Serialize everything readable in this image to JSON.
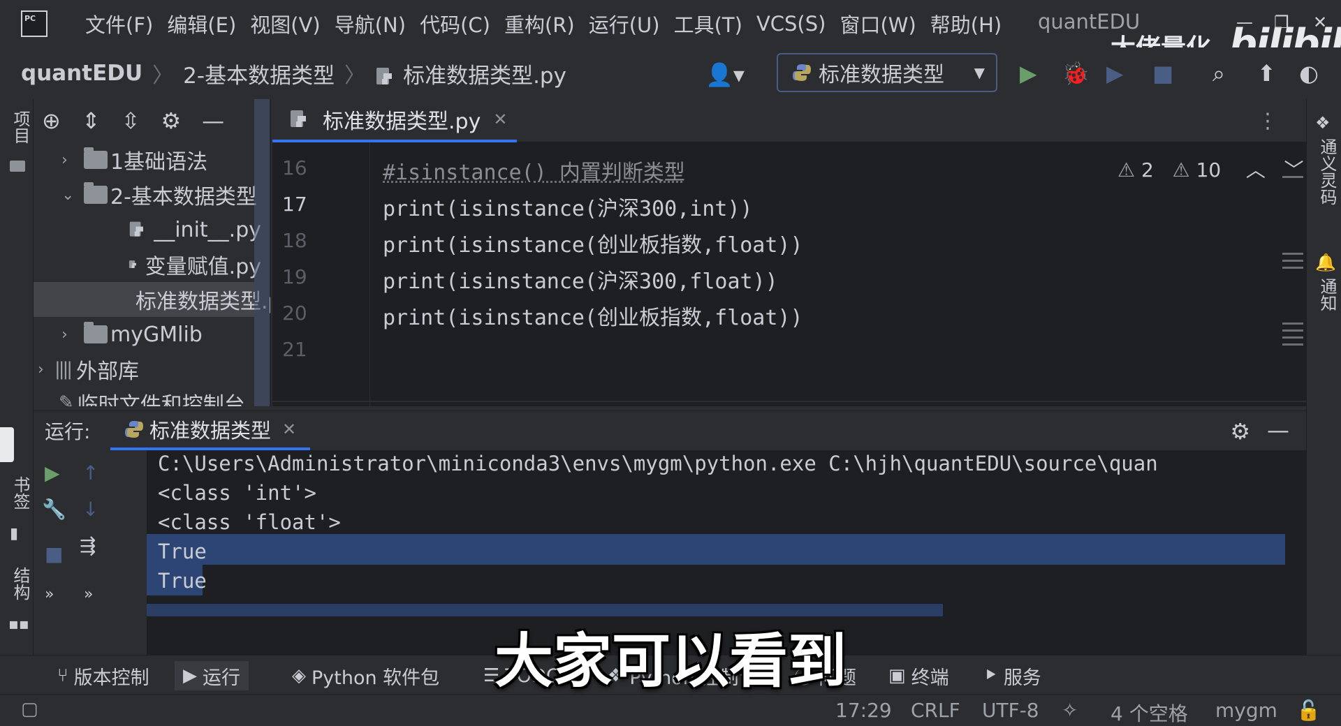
{
  "menu": {
    "logo_text": "PC",
    "items": [
      "文件(F)",
      "编辑(E)",
      "视图(V)",
      "导航(N)",
      "代码(C)",
      "重构(R)",
      "运行(U)",
      "工具(T)",
      "VCS(S)",
      "窗口(W)",
      "帮助(H)"
    ],
    "window_title": "quantEDU"
  },
  "watermark": {
    "channel": "大佬量化",
    "site_logo": "bilibili"
  },
  "breadcrumb": {
    "root": "quantEDU",
    "folder": "2-基本数据类型",
    "file": "标准数据类型.py"
  },
  "toolbar": {
    "run_config": "标准数据类型"
  },
  "left_stripe": {
    "project": "项目",
    "bookmarks": "书签",
    "structure": "结构"
  },
  "right_stripe": {
    "ai": "通义灵码",
    "notifications": "通知"
  },
  "project_tree": [
    {
      "label": "1基础语法",
      "kind": "folder",
      "expanded": false
    },
    {
      "label": "2-基本数据类型",
      "kind": "folder",
      "expanded": true
    },
    {
      "label": "__init__.py",
      "kind": "python-file"
    },
    {
      "label": "变量赋值.py",
      "kind": "python-file"
    },
    {
      "label": "标准数据类型.py",
      "kind": "python-file",
      "selected": true
    },
    {
      "label": "myGMlib",
      "kind": "folder",
      "expanded": false
    },
    {
      "label": "外部库",
      "kind": "library",
      "expanded": false
    },
    {
      "label": "临时文件和控制台",
      "kind": "scratch"
    }
  ],
  "editor": {
    "tab_label": "标准数据类型.py",
    "warnings_weak": "2",
    "warnings": "10",
    "lines": [
      {
        "num": "16",
        "text": "#isinstance() 内置判断类型"
      },
      {
        "num": "17",
        "text": "print(isinstance(沪深300,int))"
      },
      {
        "num": "18",
        "text": "print(isinstance(创业板指数,float))"
      },
      {
        "num": "19",
        "text": "print(isinstance(沪深300,float))"
      },
      {
        "num": "20",
        "text": "print(isinstance(创业板指数,float))"
      },
      {
        "num": "21",
        "text": ""
      }
    ]
  },
  "run": {
    "title": "运行:",
    "tab_label": "标准数据类型",
    "output": [
      "C:\\Users\\Administrator\\miniconda3\\envs\\mygm\\python.exe C:\\hjh\\quantEDU\\source\\quan",
      "<class 'int'>",
      "<class 'float'>",
      "True",
      "True"
    ]
  },
  "tool_windows": [
    "版本控制",
    "运行",
    "Python 软件包",
    "TODO",
    "Python 控制台",
    "问题",
    "终端",
    "服务"
  ],
  "status": {
    "position": "17:29",
    "line_sep": "CRLF",
    "encoding": "UTF-8",
    "indent": "4 个空格",
    "interpreter": "mygm"
  },
  "subtitle": "大家可以看到"
}
